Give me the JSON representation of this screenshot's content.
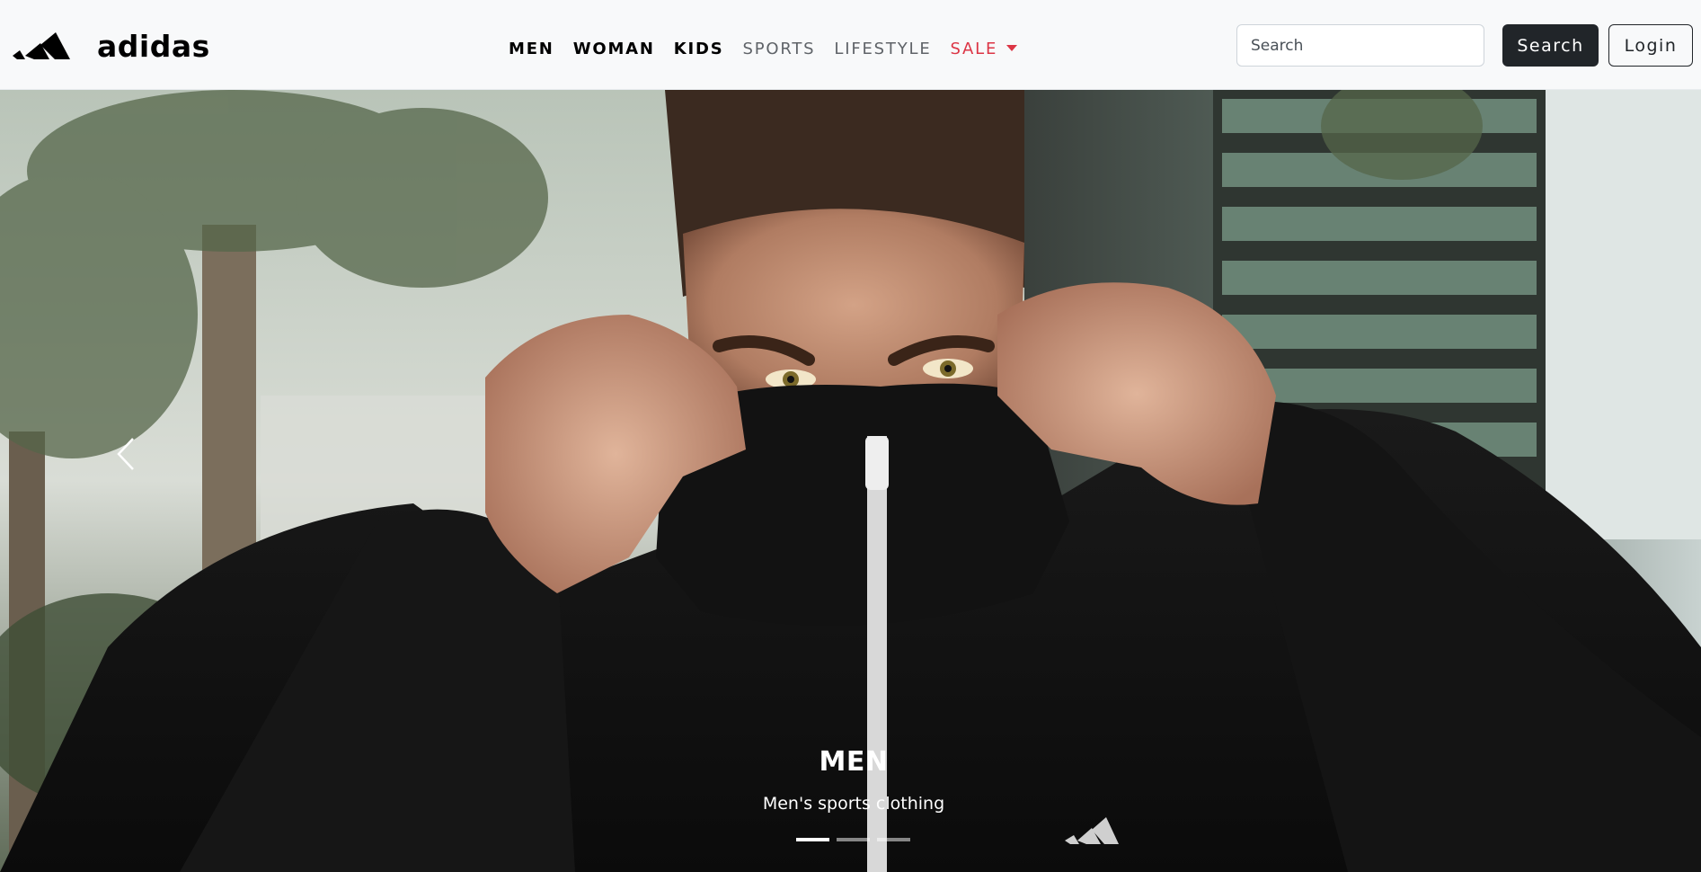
{
  "brand": {
    "name": "adidas",
    "logo_icon": "adidas-three-stripes-icon"
  },
  "nav": {
    "items": [
      {
        "label": "MEN",
        "style": "bold"
      },
      {
        "label": "WOMAN",
        "style": "bold"
      },
      {
        "label": "KIDS",
        "style": "bold"
      },
      {
        "label": "SPORTS",
        "style": "regular"
      },
      {
        "label": "LIFESTYLE",
        "style": "regular"
      },
      {
        "label": "SALE",
        "style": "sale",
        "has_dropdown": true
      }
    ],
    "sale_color": "#dc3545"
  },
  "search": {
    "placeholder": "Search",
    "value": "",
    "button_label": "Search"
  },
  "auth": {
    "login_label": "Login"
  },
  "carousel": {
    "prev_icon": "chevron-left-icon",
    "slide": {
      "title": "MEN",
      "subtitle": "Men's sports clothing"
    },
    "indicator_count": 3,
    "active_index": 0
  },
  "colors": {
    "navbar_bg": "#f8f9fa",
    "dark_button": "#212529",
    "caption_text": "#ffffff"
  }
}
